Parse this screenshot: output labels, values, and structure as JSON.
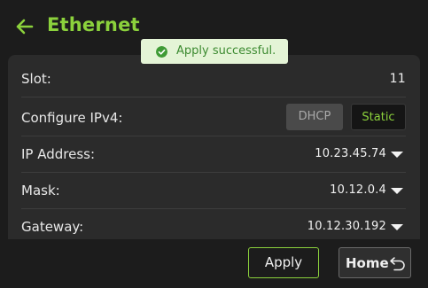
{
  "header": {
    "title": "Ethernet",
    "back_icon": "arrow-left-icon"
  },
  "toast": {
    "message": "Apply successful.",
    "icon": "check-circle-icon"
  },
  "settings": {
    "slot": {
      "label": "Slot:",
      "value": "11"
    },
    "ipv4": {
      "label": "Configure IPv4:",
      "options": [
        "DHCP",
        "Static"
      ],
      "selected": "Static"
    },
    "ip_address": {
      "label": "IP Address:",
      "value": "10.23.45.74"
    },
    "mask": {
      "label": "Mask:",
      "value": "10.12.0.4"
    },
    "gateway": {
      "label": "Gateway:",
      "value": "10.12.30.192"
    }
  },
  "footer": {
    "apply_label": "Apply",
    "home_label": "Home",
    "home_icon": "return-icon"
  },
  "colors": {
    "accent": "#8bd13c",
    "background": "#1c1c1c",
    "panel": "#2b2b2b",
    "toast_bg": "#e4f4d6",
    "toast_text": "#3b8a30"
  }
}
